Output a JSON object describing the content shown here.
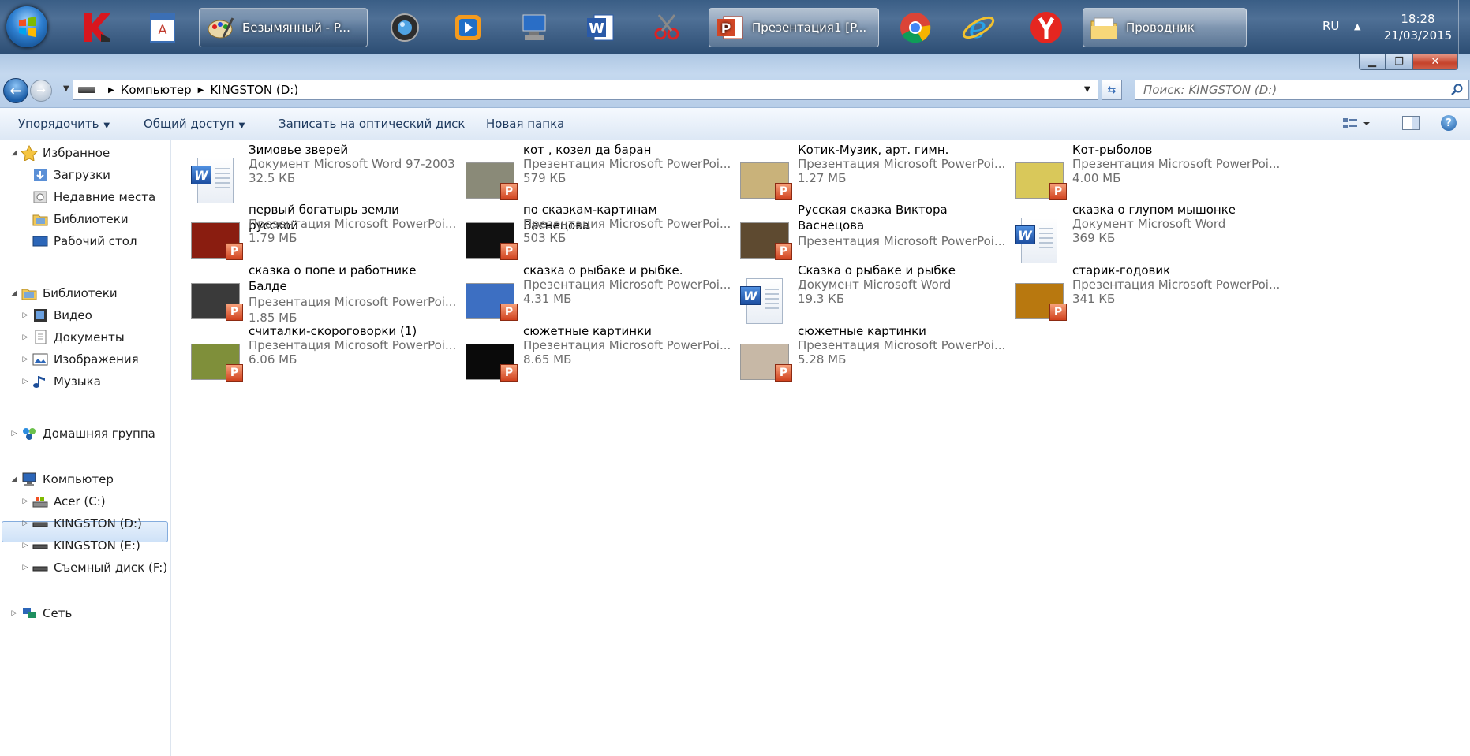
{
  "taskbar": {
    "windows": [
      {
        "label": "Безымянный - P...",
        "icon": "paint-icon"
      },
      {
        "label": "Презентация1 [P...",
        "icon": "powerpoint-icon"
      },
      {
        "label": "Проводник",
        "icon": "explorer-folder-icon"
      }
    ],
    "pinned": [
      "kaspersky-icon",
      "notepad-icon",
      "media-center-icon",
      "media-player-icon",
      "remote-desktop-icon",
      "word-icon",
      "snipping-tool-icon",
      "chrome-icon",
      "internet-explorer-icon",
      "yandex-browser-icon"
    ],
    "tray": {
      "lang": "RU",
      "time": "18:28",
      "date": "21/03/2015"
    }
  },
  "address": {
    "crumbs": [
      "Компьютер",
      "KINGSTON (D:)"
    ],
    "search_placeholder": "Поиск: KINGSTON (D:)"
  },
  "commands": {
    "organize": "Упорядочить",
    "share": "Общий доступ",
    "burn": "Записать на оптический диск",
    "new_folder": "Новая папка"
  },
  "nav": {
    "favorites": "Избранное",
    "downloads": "Загрузки",
    "recent": "Недавние места",
    "libraries_fav": "Библиотеки",
    "desktop": "Рабочий стол",
    "libraries": "Библиотеки",
    "video": "Видео",
    "documents": "Документы",
    "images": "Изображения",
    "music": "Музыка",
    "homegroup": "Домашняя группа",
    "computer": "Компьютер",
    "drive_c": "Acer (C:)",
    "drive_d": "KINGSTON (D:)",
    "drive_e": "KINGSTON (E:)",
    "drive_f": "Съемный диск (F:)",
    "network": "Сеть"
  },
  "files": [
    {
      "name": "Зимовье зверей",
      "type": "Документ Microsoft Word 97-2003",
      "size": "32.5 КБ",
      "kind": "word"
    },
    {
      "name": "кот , козел да баран",
      "type": "Презентация Microsoft PowerPoi...",
      "size": "579 КБ",
      "kind": "ppt",
      "thumb": "#8a8a78"
    },
    {
      "name": "Котик-Музик, арт. гимн.",
      "type": "Презентация Microsoft PowerPoi...",
      "size": "1.27 МБ",
      "kind": "ppt",
      "thumb": "#c9b27a"
    },
    {
      "name": "Кот-рыболов",
      "type": "Презентация Microsoft PowerPoi...",
      "size": "4.00 МБ",
      "kind": "ppt",
      "thumb": "#d9c85a"
    },
    {
      "name": "первый богатырь земли русской",
      "type": "Презентация Microsoft PowerPoi...",
      "size": "1.79 МБ",
      "kind": "ppt",
      "thumb": "#8a1d10"
    },
    {
      "name": "по сказкам-картинам  Васнецова",
      "type": "Презентация Microsoft PowerPoi...",
      "size": "503 КБ",
      "kind": "ppt",
      "thumb": "#111111"
    },
    {
      "name": "Русская сказка Виктора Васнецова",
      "type": "Презентация Microsoft PowerPoi...",
      "size": "",
      "kind": "ppt",
      "thumb": "#5e4a30"
    },
    {
      "name": "сказка о глупом мышонке",
      "type": "Документ Microsoft Word",
      "size": "369 КБ",
      "kind": "word"
    },
    {
      "name": "сказка о попе и работнике Балде",
      "type": "Презентация Microsoft PowerPoi...",
      "size": "1.85 МБ",
      "kind": "ppt",
      "thumb": "#3a3a3a"
    },
    {
      "name": "сказка о рыбаке и рыбке.",
      "type": "Презентация Microsoft PowerPoi...",
      "size": "4.31 МБ",
      "kind": "ppt",
      "thumb": "#3d6fc2"
    },
    {
      "name": "Сказка о рыбаке и рыбке",
      "type": "Документ Microsoft Word",
      "size": "19.3 КБ",
      "kind": "word"
    },
    {
      "name": "старик-годовик",
      "type": "Презентация Microsoft PowerPoi...",
      "size": "341 КБ",
      "kind": "ppt",
      "thumb": "#b8780f"
    },
    {
      "name": "считалки-скороговорки (1)",
      "type": "Презентация Microsoft PowerPoi...",
      "size": "6.06 МБ",
      "kind": "ppt",
      "thumb": "#7f8f3a"
    },
    {
      "name": "сюжетные  картинки",
      "type": "Презентация Microsoft PowerPoi...",
      "size": "8.65 МБ",
      "kind": "ppt",
      "thumb": "#0a0a0a"
    },
    {
      "name": "сюжетные картинки",
      "type": "Презентация Microsoft PowerPoi...",
      "size": "5.28 МБ",
      "kind": "ppt",
      "thumb": "#c7b8a6"
    }
  ]
}
